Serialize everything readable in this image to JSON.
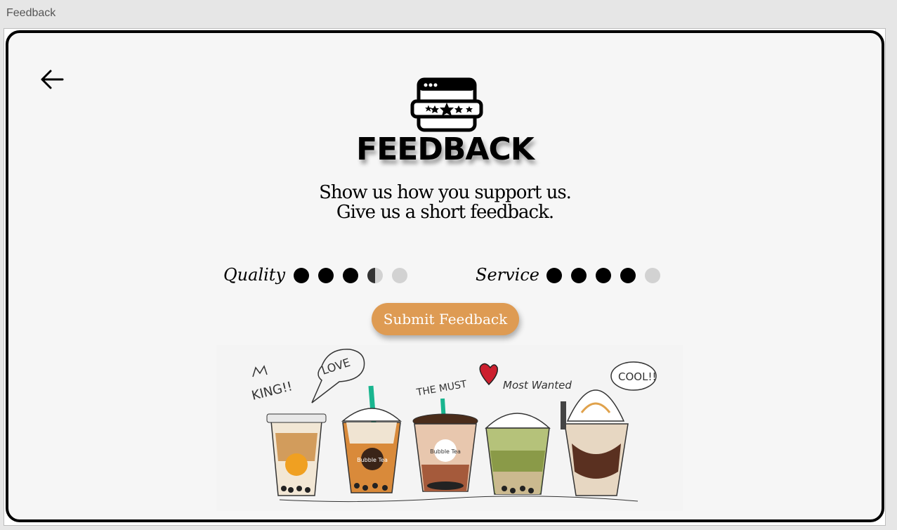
{
  "window": {
    "title": "Feedback"
  },
  "header": {
    "title": "FEEDBACK"
  },
  "subtitle": {
    "line1": "Show us how you support us.",
    "line2": "Give us a short feedback."
  },
  "ratings": [
    {
      "label": "Quality",
      "value": 3.5,
      "max": 5
    },
    {
      "label": "Service",
      "value": 4,
      "max": 5
    }
  ],
  "actions": {
    "submit_label": "Submit Feedback"
  },
  "illustration": {
    "texts": [
      "KING!!",
      "LOVE",
      "THE MUST",
      "Most Wanted",
      "COOL!!"
    ],
    "cup_labels": [
      "Bubble Tea",
      "Bubble Tea",
      "Bubble Tea"
    ]
  },
  "colors": {
    "accent": "#de9b53",
    "dot_on": "#000000",
    "dot_off": "#d2d2d2",
    "card_bg": "#f6f6f6"
  },
  "icons": {
    "back": "arrow-left-icon",
    "logo": "rating-window-icon"
  }
}
